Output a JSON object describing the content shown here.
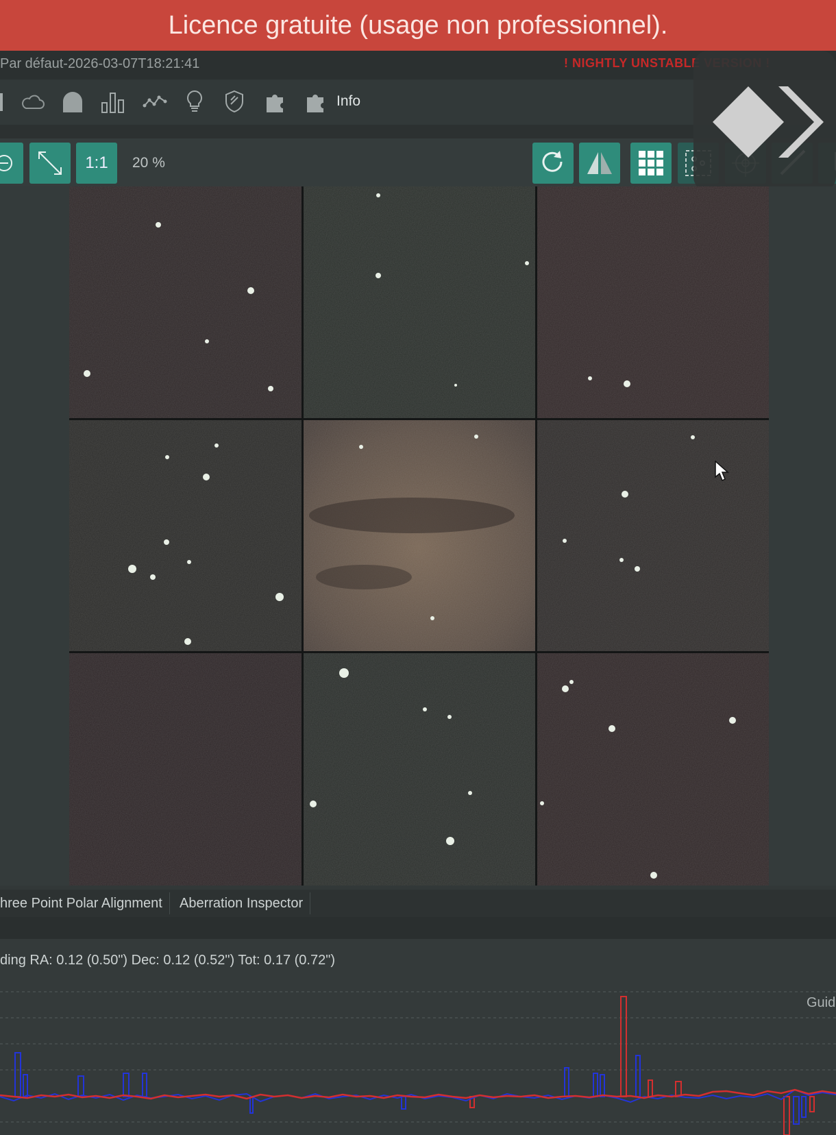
{
  "banner": {
    "text": "Licence gratuite (usage non professionnel)."
  },
  "titlebar": {
    "profile": "Par défaut-2026-03-07T18:21:41",
    "build_warning": "! NIGHTLY UNSTABLE VERSION !"
  },
  "menubar": {
    "items": [
      {
        "icon": "cloud-icon"
      },
      {
        "icon": "observatory-icon"
      },
      {
        "icon": "bar-chart-icon"
      },
      {
        "icon": "graph-icon"
      },
      {
        "icon": "lightbulb-icon"
      },
      {
        "icon": "shield-icon"
      },
      {
        "icon": "plugin-icon"
      },
      {
        "icon": "plugin-icon"
      }
    ],
    "info_label": "Info"
  },
  "toolbar": {
    "fit_label": "1:1",
    "zoom_level": "20 %"
  },
  "tabs": [
    "hree Point Polar Alignment",
    "Aberration Inspector"
  ],
  "guiding": {
    "stats": "ding  RA: 0.12 (0.50\")  Dec: 0.12 (0.52\")  Tot: 0.17 (0.72\")",
    "legend_label": "Guid"
  },
  "colors": {
    "accent": "#2f8c7b",
    "banner": "#c8463c",
    "ra_line": "#d32f2f",
    "dec_line": "#1e3fd8"
  }
}
